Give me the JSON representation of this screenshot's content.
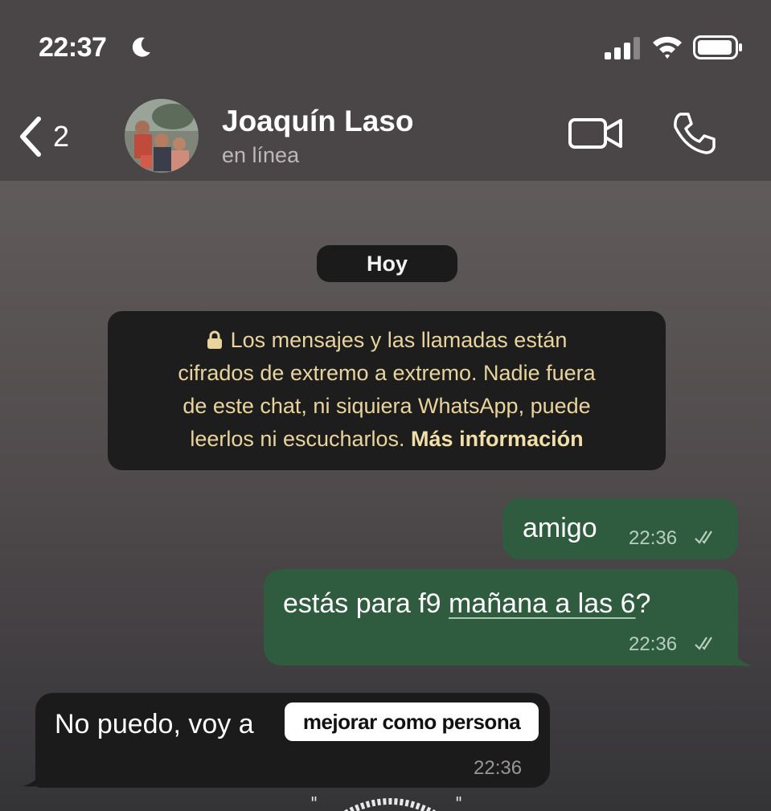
{
  "status_bar": {
    "time": "22:37",
    "icons": [
      "moon-icon",
      "signal-icon",
      "wifi-icon",
      "battery-icon"
    ]
  },
  "header": {
    "back_count": "2",
    "contact_name": "Joaquín Laso",
    "contact_status": "en línea",
    "icons": [
      "back-chevron-icon",
      "video-call-icon",
      "phone-icon"
    ]
  },
  "chat": {
    "date_label": "Hoy",
    "encryption_notice": {
      "lines": [
        "Los mensajes y las llamadas están",
        "cifrados de extremo a extremo. Nadie fuera",
        "de este chat, ni siquiera WhatsApp, puede",
        "leerlos ni escucharlos."
      ],
      "link_label": "Más información"
    },
    "messages": [
      {
        "direction": "out",
        "text": "amigo",
        "time": "22:36",
        "status": "read"
      },
      {
        "direction": "out",
        "text_before": "estás para f9 ",
        "link": "mañana a las 6",
        "text_after": "?",
        "time": "22:36",
        "status": "read"
      },
      {
        "direction": "in",
        "text": "No puedo, voy a",
        "sticker": "mejorar como persona",
        "time": "22:36"
      }
    ]
  },
  "colors": {
    "header_bg": "#4a4546",
    "outgoing_bubble": "#2f5c3f",
    "incoming_bubble": "#1c1b1c",
    "notice_text": "#e8d49c"
  }
}
